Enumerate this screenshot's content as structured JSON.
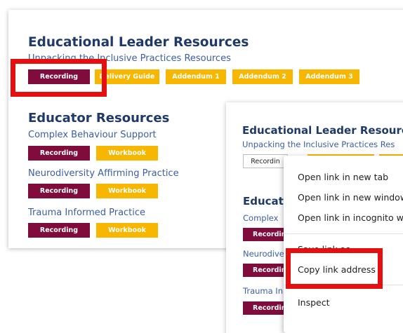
{
  "left_panel": {
    "leader_heading": "Educational Leader Resources",
    "leader_subheading": "Unpacking the Inclusive Practices Resources",
    "leader_buttons": [
      "Recording",
      "Delivery Guide",
      "Addendum 1",
      "Addendum 2",
      "Addendum 3"
    ],
    "educator_heading": "Educator Resources",
    "sections": [
      {
        "title": "Complex Behaviour Support",
        "recording": "Recording",
        "workbook": "Workbook"
      },
      {
        "title": "Neurodiversity Affirming Practice",
        "recording": "Recording",
        "workbook": "Workbook"
      },
      {
        "title": "Trauma Informed Practice",
        "recording": "Recording",
        "workbook": "Workbook"
      }
    ]
  },
  "right_panel": {
    "leader_heading": "Educational Leader Resourc",
    "leader_subheading": "Unpacking the Inclusive Practices Res",
    "recording_button": "Recordin",
    "educator_heading": "Educat",
    "section_titles": [
      "Complex",
      "Neurodive",
      "Trauma In"
    ],
    "recording_label": "Recordin"
  },
  "context_menu": {
    "items": [
      "Open link in new tab",
      "Open link in new window",
      "Open link in incognito wind",
      "Save link as...",
      "Copy link address",
      "Inspect"
    ]
  },
  "colors": {
    "heading": "#1f3a68",
    "subheading": "#3a5fa8",
    "recording_button": "#800c3c",
    "secondary_button": "#f7b700",
    "highlight": "#e60f0f"
  }
}
